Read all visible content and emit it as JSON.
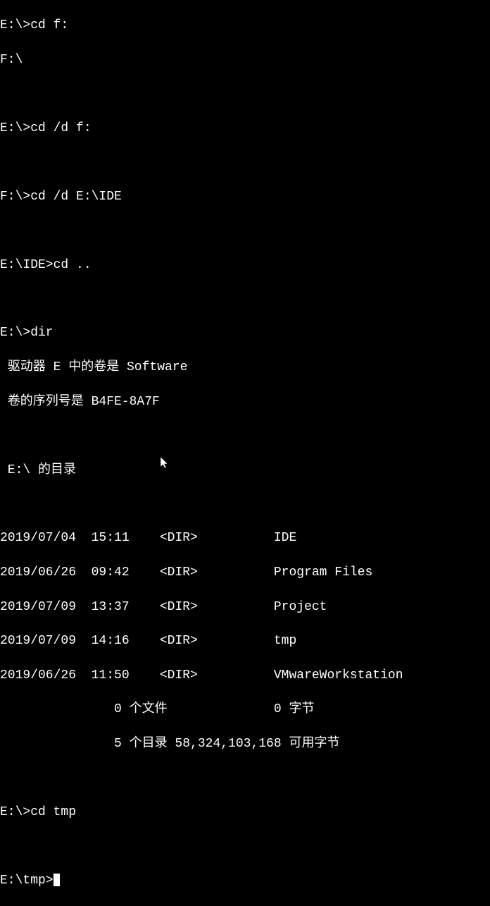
{
  "lines": {
    "l1": "E:\\>cd f:",
    "l2": "F:\\",
    "l3": "",
    "l4": "E:\\>cd /d f:",
    "l5": "",
    "l6": "F:\\>cd /d E:\\IDE",
    "l7": "",
    "l8": "E:\\IDE>cd ..",
    "l9": "",
    "l10": "E:\\>dir",
    "l11": " 驱动器 E 中的卷是 Software",
    "l12": " 卷的序列号是 B4FE-8A7F",
    "l13": "",
    "l14": " E:\\ 的目录",
    "l15": "",
    "l16": "2019/07/04  15:11    <DIR>          IDE",
    "l17": "2019/06/26  09:42    <DIR>          Program Files",
    "l18": "2019/07/09  13:37    <DIR>          Project",
    "l19": "2019/07/09  14:16    <DIR>          tmp",
    "l20": "2019/06/26  11:50    <DIR>          VMwareWorkstation",
    "l21": "               0 个文件              0 字节",
    "l22": "               5 个目录 58,324,103,168 可用字节",
    "l23": "",
    "l24": "E:\\>cd tmp",
    "l25": "",
    "l26": "E:\\tmp>"
  }
}
